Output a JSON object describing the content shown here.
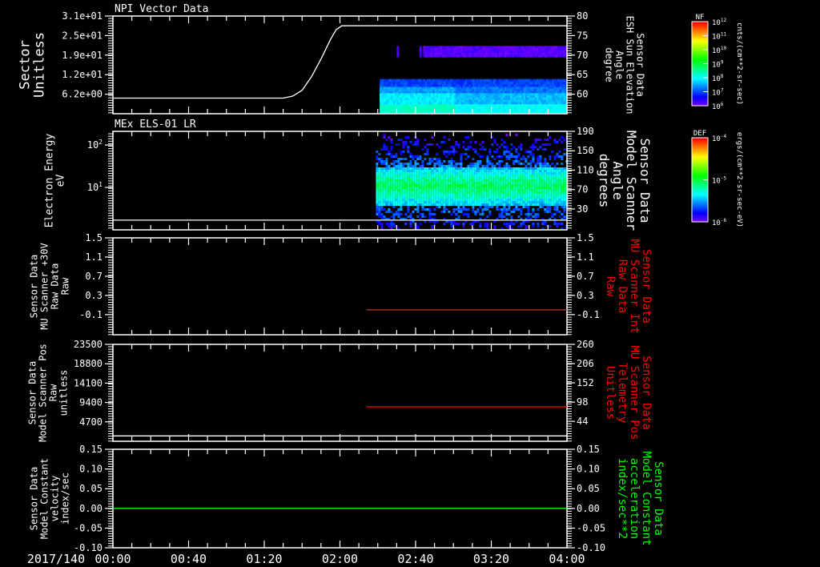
{
  "colors": {
    "background": "#000000",
    "axis": "#ffffff",
    "red_series": "#ff0000",
    "green_series": "#00ff00",
    "gray_series": "#808080"
  },
  "xaxis": {
    "date_label": "2017/140",
    "range_minutes": [
      0,
      240
    ],
    "tick_labels": [
      "00:00",
      "00:40",
      "01:20",
      "02:00",
      "02:40",
      "03:20",
      "04:00"
    ]
  },
  "colorbars": [
    {
      "title": "NF",
      "units": "cnts/(cm**2-sr-sec)",
      "scale": "log",
      "range": [
        1000000.0,
        1000000000000.0
      ],
      "tick_labels": [
        {
          "base": "10",
          "exp": "12"
        },
        {
          "base": "10",
          "exp": "11"
        },
        {
          "base": "10",
          "exp": "10"
        },
        {
          "base": "10",
          "exp": "9"
        },
        {
          "base": "10",
          "exp": "8"
        },
        {
          "base": "10",
          "exp": "7"
        },
        {
          "base": "10",
          "exp": "6"
        }
      ]
    },
    {
      "title": "DEF",
      "units": "ergs/(cm**2-sr-sec-eV)",
      "scale": "log",
      "range": [
        1e-06,
        0.0001
      ],
      "tick_labels": [
        {
          "base": "10",
          "exp": "-4"
        },
        {
          "base": "10",
          "exp": "-5"
        },
        {
          "base": "10",
          "exp": "-6"
        }
      ]
    }
  ],
  "chart_data": [
    {
      "type": "heatmap",
      "title": "NPI Vector Data",
      "ylabel_left": [
        "Sector",
        "Unitless"
      ],
      "ylabel_right": [
        "Sensor Data",
        "ESH Sun Elevation",
        "Angle",
        "degree"
      ],
      "ylabel_right_color": "#ffffff",
      "yleft": {
        "scale": "linear",
        "ylim": [
          0,
          31
        ],
        "ticks": [
          31,
          24.8,
          18.6,
          12.4,
          6.2
        ],
        "tick_labels": [
          "3.1e+01",
          "2.5e+01",
          "1.9e+01",
          "1.2e+01",
          "6.2e+00"
        ]
      },
      "yright": {
        "scale": "linear",
        "ylim": [
          55,
          80
        ],
        "ticks": [
          80,
          75,
          70,
          65,
          60
        ],
        "tick_labels": [
          "80",
          "75",
          "70",
          "65",
          "60"
        ]
      },
      "heatmap": {
        "colorbar": "NF",
        "start_minute": 141,
        "bands": [
          {
            "y_range": [
              18,
              21.5
            ],
            "log_value": 6.2,
            "sparse_until_minute": 164
          },
          {
            "y_range": [
              8.5,
              11
            ],
            "log_value": 7.0
          },
          {
            "y_range": [
              6.5,
              8.5
            ],
            "log_value": 7.5
          },
          {
            "y_range": [
              3,
              6.5
            ],
            "log_value": 7.9
          },
          {
            "y_range": [
              0,
              3
            ],
            "log_value": 8.3
          }
        ]
      },
      "lines": [
        {
          "axis": "right",
          "color": "#ffffff",
          "points": [
            [
              0,
              59
            ],
            [
              90,
              59
            ],
            [
              95,
              59.5
            ],
            [
              100,
              61
            ],
            [
              105,
              64.5
            ],
            [
              110,
              69
            ],
            [
              115,
              74
            ],
            [
              118,
              76.5
            ],
            [
              121,
              77.5
            ],
            [
              240,
              77.5
            ]
          ]
        }
      ]
    },
    {
      "type": "heatmap",
      "title": "MEx ELS-01 LR",
      "ylabel_left": [
        "Electron Energy",
        "eV"
      ],
      "ylabel_right": [
        "Sensor Data",
        "Model Scanner",
        "Angle",
        "degrees"
      ],
      "ylabel_right_color": "#ffffff",
      "yleft": {
        "scale": "log",
        "ylim": [
          1,
          210
        ],
        "ticks": [
          100,
          10
        ],
        "tick_labels": [
          {
            "base": "10",
            "exp": "2"
          },
          {
            "base": "10",
            "exp": "1"
          }
        ]
      },
      "yright": {
        "scale": "linear",
        "ylim": [
          -13,
          190
        ],
        "ticks": [
          190,
          150,
          110,
          70,
          30
        ],
        "tick_labels": [
          "190",
          "150",
          "110",
          "70",
          "30"
        ]
      },
      "heatmap": {
        "colorbar": "DEF",
        "start_minute": 139,
        "peak_energy_range_eV": [
          4,
          32
        ],
        "noise_energy_range_eV": [
          1,
          170
        ]
      },
      "lines": [
        {
          "axis": "right",
          "color": "#ffffff",
          "points": [
            [
              0,
              7
            ],
            [
              240,
              7
            ]
          ]
        }
      ]
    },
    {
      "type": "line",
      "ylabel_left": [
        "Sensor Data",
        "MU Scanner +30V",
        "Raw Data",
        "Raw"
      ],
      "ylabel_right": [
        "Sensor Data",
        "MU Scanner Int",
        "Raw Data",
        "Raw"
      ],
      "ylabel_right_color": "#ff0000",
      "yleft": {
        "scale": "linear",
        "ylim": [
          -0.52,
          1.5
        ],
        "ticks": [
          1.5,
          1.1,
          0.7,
          0.3,
          -0.1
        ],
        "tick_labels": [
          "1.5",
          "1.1",
          "0.7",
          "0.3",
          "-0.1"
        ]
      },
      "yright": {
        "scale": "linear",
        "ylim": [
          -0.52,
          1.5
        ],
        "ticks": [
          1.5,
          1.1,
          0.7,
          0.3,
          -0.1
        ],
        "tick_labels": [
          "1.5",
          "1.1",
          "0.7",
          "0.3",
          "-0.1"
        ]
      },
      "lines": [
        {
          "axis": "right",
          "color": "#c03030",
          "points": [
            [
              134,
              0.0
            ],
            [
              240,
              0.0
            ]
          ]
        }
      ]
    },
    {
      "type": "line",
      "ylabel_left": [
        "Sensor Data",
        "Model Scanner Pos",
        "Raw",
        "unitless"
      ],
      "ylabel_right": [
        "Sensor Data",
        "MU Scanner Pos",
        "Telemetry",
        "Unitless"
      ],
      "ylabel_right_color": "#ff0000",
      "yleft": {
        "scale": "linear",
        "ylim": [
          0,
          23500
        ],
        "ticks": [
          23500,
          18800,
          14100,
          9400,
          4700
        ],
        "tick_labels": [
          "23500",
          "18800",
          "14100",
          "9400",
          "4700"
        ]
      },
      "yright": {
        "scale": "linear",
        "ylim": [
          -12,
          260
        ],
        "ticks": [
          260,
          206,
          152,
          98,
          44
        ],
        "tick_labels": [
          "260",
          "206",
          "152",
          "98",
          "44"
        ]
      },
      "lines": [
        {
          "axis": "left",
          "color": "#ffffff",
          "points": [
            [
              0,
              1300
            ],
            [
              240,
              1300
            ]
          ]
        },
        {
          "axis": "right",
          "color": "#ff0000",
          "points": [
            [
              134,
              85
            ],
            [
              240,
              85
            ]
          ]
        }
      ]
    },
    {
      "type": "line",
      "ylabel_left": [
        "Sensor Data",
        "Model Constant",
        "velocity",
        "index/sec"
      ],
      "ylabel_right": [
        "Sensor Data",
        "Model Constant",
        "acceleration",
        "index/sec**2"
      ],
      "ylabel_right_color": "#00ff00",
      "yleft": {
        "scale": "linear",
        "ylim": [
          -0.1,
          0.15
        ],
        "ticks": [
          0.15,
          0.1,
          0.05,
          0.0,
          -0.05,
          -0.1
        ],
        "tick_labels": [
          "0.15",
          "0.10",
          "0.05",
          "0.00",
          "-0.05",
          "-0.10"
        ]
      },
      "yright": {
        "scale": "linear",
        "ylim": [
          -0.1,
          0.15
        ],
        "ticks": [
          0.15,
          0.1,
          0.05,
          0.0,
          -0.05,
          -0.1
        ],
        "tick_labels": [
          "0.15",
          "0.10",
          "0.05",
          "0.00",
          "-0.05",
          "-0.10"
        ]
      },
      "lines": [
        {
          "axis": "left",
          "color": "#00ff00",
          "points": [
            [
              0,
              0
            ],
            [
              240,
              0
            ]
          ]
        }
      ]
    }
  ]
}
